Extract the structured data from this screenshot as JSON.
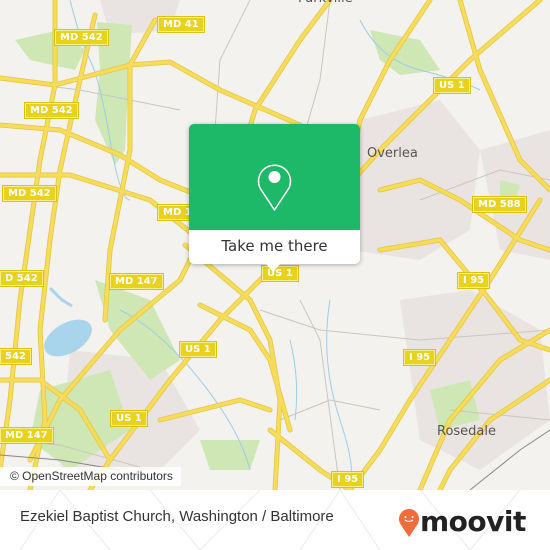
{
  "map": {
    "colors": {
      "background": "#f3f2ee",
      "road": "#f6dc5a",
      "park": "#cfe7b4",
      "water": "#a8d4ec",
      "urban": "#e9e4e1"
    },
    "road_labels": [
      {
        "id": "md542-a",
        "text": "MD 542"
      },
      {
        "id": "md41",
        "text": "MD 41"
      },
      {
        "id": "md542-b",
        "text": "MD 542"
      },
      {
        "id": "md542-c",
        "text": "MD 542"
      },
      {
        "id": "md1",
        "text": "MD 1"
      },
      {
        "id": "md542-d",
        "text": "D 542"
      },
      {
        "id": "md147-a",
        "text": "MD 147"
      },
      {
        "id": "us1-popup",
        "text": "US 1"
      },
      {
        "id": "us1-a",
        "text": "US 1"
      },
      {
        "id": "us1-b",
        "text": "US 1"
      },
      {
        "id": "md542-e",
        "text": "542"
      },
      {
        "id": "md147-b",
        "text": "MD 147"
      },
      {
        "id": "us1-ne",
        "text": "US 1"
      },
      {
        "id": "md588",
        "text": "MD 588"
      },
      {
        "id": "i95-a",
        "text": "I 95"
      },
      {
        "id": "i95-b",
        "text": "I 95"
      },
      {
        "id": "i95-c",
        "text": "I 95"
      }
    ],
    "places": [
      {
        "id": "parkville",
        "text": "Parkville"
      },
      {
        "id": "overlea",
        "text": "Overlea"
      },
      {
        "id": "rosedale",
        "text": "Rosedale"
      }
    ],
    "attribution": "© OpenStreetMap contributors"
  },
  "popup": {
    "action_label": "Take me there",
    "icon": "map-pin-icon",
    "color": "#1db868"
  },
  "footer": {
    "title": "Ezekiel Baptist Church, Washington / Baltimore",
    "logo_text": "moovit",
    "logo_color": "#f26b3a"
  }
}
